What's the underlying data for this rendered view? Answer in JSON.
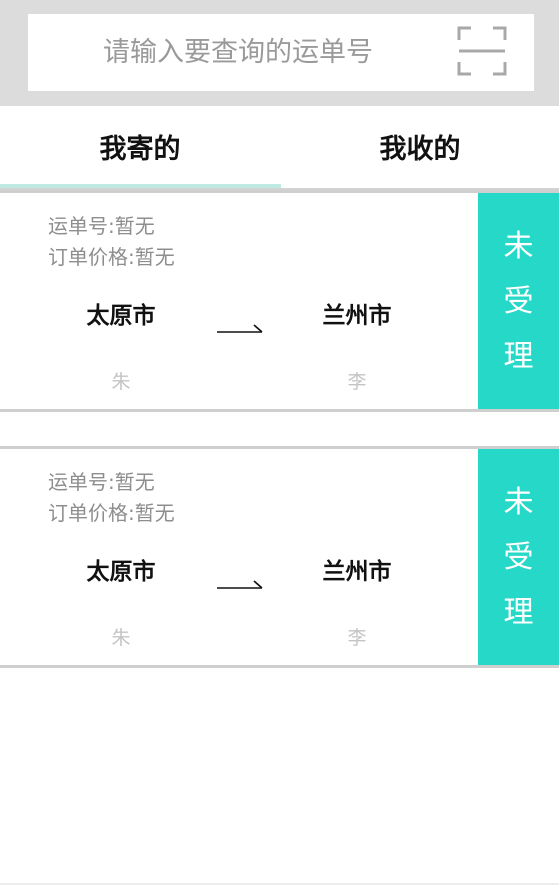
{
  "search": {
    "placeholder": "请输入要查询的运单号",
    "scan_icon": "scan-icon"
  },
  "tabs": [
    {
      "label": "我寄的",
      "active": true
    },
    {
      "label": "我收的",
      "active": false
    }
  ],
  "colors": {
    "accent": "#26d8c8",
    "tab_underline": "#bfe9e3",
    "header_bg": "#dcdcdc"
  },
  "orders": [
    {
      "waybill": "运单号:暂无",
      "price": "订单价格:暂无",
      "from_city": "太原市",
      "to_city": "兰州市",
      "sender": "朱",
      "receiver": "李",
      "status": [
        "未",
        "受",
        "理"
      ]
    },
    {
      "waybill": "运单号:暂无",
      "price": "订单价格:暂无",
      "from_city": "太原市",
      "to_city": "兰州市",
      "sender": "朱",
      "receiver": "李",
      "status": [
        "未",
        "受",
        "理"
      ]
    }
  ]
}
